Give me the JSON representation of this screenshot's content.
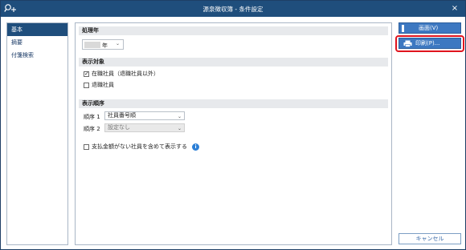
{
  "window": {
    "title": "源泉徴収簿 - 条件設定",
    "close_label": "×"
  },
  "sidebar": {
    "items": [
      {
        "label": "基本",
        "active": true
      },
      {
        "label": "摘要",
        "active": false
      },
      {
        "label": "付箋検索",
        "active": false
      }
    ]
  },
  "main": {
    "section_year": {
      "header": "処理年",
      "year_value": "",
      "year_unit": "年"
    },
    "section_target": {
      "header": "表示対象",
      "options": [
        {
          "label": "在職社員（退職社員以外）",
          "checked": true
        },
        {
          "label": "退職社員",
          "checked": false
        }
      ]
    },
    "section_order": {
      "header": "表示順序",
      "orders": [
        {
          "label": "順序 1",
          "value": "社員番号順",
          "disabled": false
        },
        {
          "label": "順序 2",
          "value": "設定なし",
          "disabled": true
        }
      ],
      "include_unpaid": {
        "label": "支払金額がない社員を含めて表示する",
        "checked": false
      }
    }
  },
  "buttons": {
    "screen_label": "画面(V)",
    "print_label": "印刷(P)...",
    "cancel_label": "キャンセル"
  },
  "icons": {
    "app": "search-plus-icon",
    "close": "close-icon",
    "info": "info-icon",
    "printer": "printer-icon",
    "check": "checkmark-icon"
  },
  "colors": {
    "titlebar": "#1f4e7c",
    "accent": "#3d78c1",
    "highlight": "#e0141e"
  }
}
